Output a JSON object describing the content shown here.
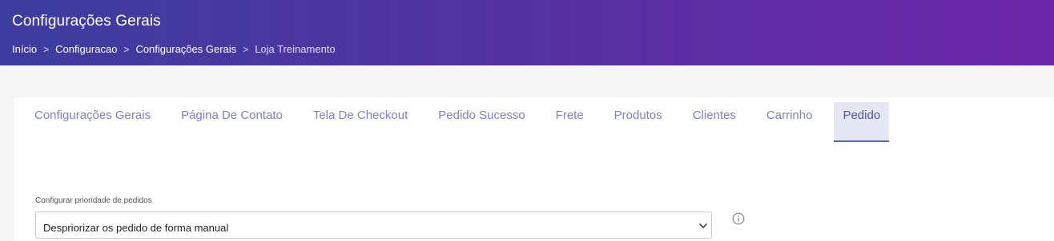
{
  "header": {
    "title": "Configurações Gerais",
    "breadcrumb": [
      {
        "label": "Início"
      },
      {
        "label": "Configuracao"
      },
      {
        "label": "Configurações Gerais"
      },
      {
        "label": "Loja Treinamento"
      }
    ],
    "separator": ">"
  },
  "tabs": [
    {
      "label": "Configurações Gerais"
    },
    {
      "label": "Página De Contato"
    },
    {
      "label": "Tela De Checkout"
    },
    {
      "label": "Pedido Sucesso"
    },
    {
      "label": "Frete"
    },
    {
      "label": "Produtos"
    },
    {
      "label": "Clientes"
    },
    {
      "label": "Carrinho"
    },
    {
      "label": "Pedido",
      "active": true
    }
  ],
  "form": {
    "priority_label": "Configurar prioridade de pedidos",
    "priority_value": "Despriorizar os pedido de forma manual"
  },
  "icons": {
    "info": "info-icon",
    "dropdown": "chevron-down-icon"
  },
  "colors": {
    "header_gradient_start": "#3d3d9f",
    "header_gradient_end": "#6b26a8",
    "tab_text": "#7b83c0",
    "tab_active_bg": "#e5e7f4",
    "tab_active_border": "#5966b3"
  }
}
